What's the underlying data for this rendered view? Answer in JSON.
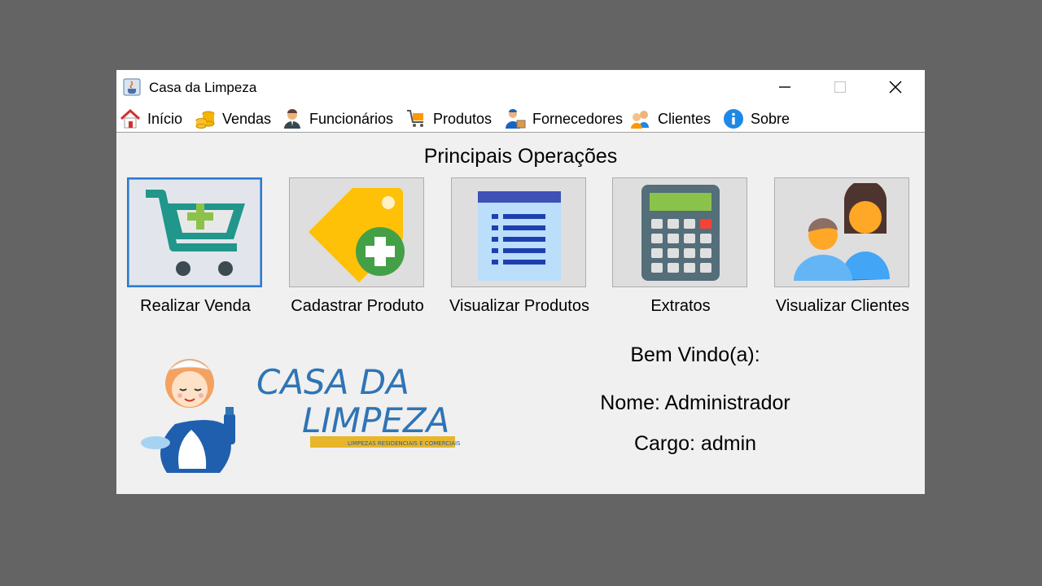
{
  "window": {
    "title": "Casa da Limpeza",
    "controls": [
      "minimize",
      "maximize",
      "close"
    ]
  },
  "menu": [
    {
      "label": "Início",
      "icon": "home-icon"
    },
    {
      "label": "Vendas",
      "icon": "coins-icon"
    },
    {
      "label": "Funcionários",
      "icon": "employee-icon"
    },
    {
      "label": "Produtos",
      "icon": "products-cart-icon"
    },
    {
      "label": "Fornecedores",
      "icon": "supplier-icon"
    },
    {
      "label": "Clientes",
      "icon": "clients-icon"
    },
    {
      "label": "Sobre",
      "icon": "info-icon"
    }
  ],
  "main": {
    "heading": "Principais Operações",
    "operations": [
      {
        "label": "Realizar Venda",
        "icon": "cart-add-icon",
        "focused": true
      },
      {
        "label": "Cadastrar Produto",
        "icon": "tag-add-icon"
      },
      {
        "label": "Visualizar Produtos",
        "icon": "list-icon"
      },
      {
        "label": "Extratos",
        "icon": "calculator-icon"
      },
      {
        "label": "Visualizar Clientes",
        "icon": "people-icon"
      }
    ]
  },
  "logo": {
    "line1": "CASA DA",
    "line2": "LIMPEZA",
    "tagline": "LIMPEZAS RESIDENCIAIS E COMERCIAIS"
  },
  "user": {
    "welcome": "Bem Vindo(a):",
    "name_text": "Nome: Administrador",
    "role_text": "Cargo: admin"
  },
  "colors": {
    "desktop": "#646464",
    "window_bg": "#f0f0f0",
    "accent_green": "#4caf50",
    "cart_teal": "#21968a",
    "tag_yellow": "#ffc107",
    "list_blue": "#3f51b5",
    "logo_blue": "#2f74b5",
    "logo_gold": "#e8b62a"
  }
}
